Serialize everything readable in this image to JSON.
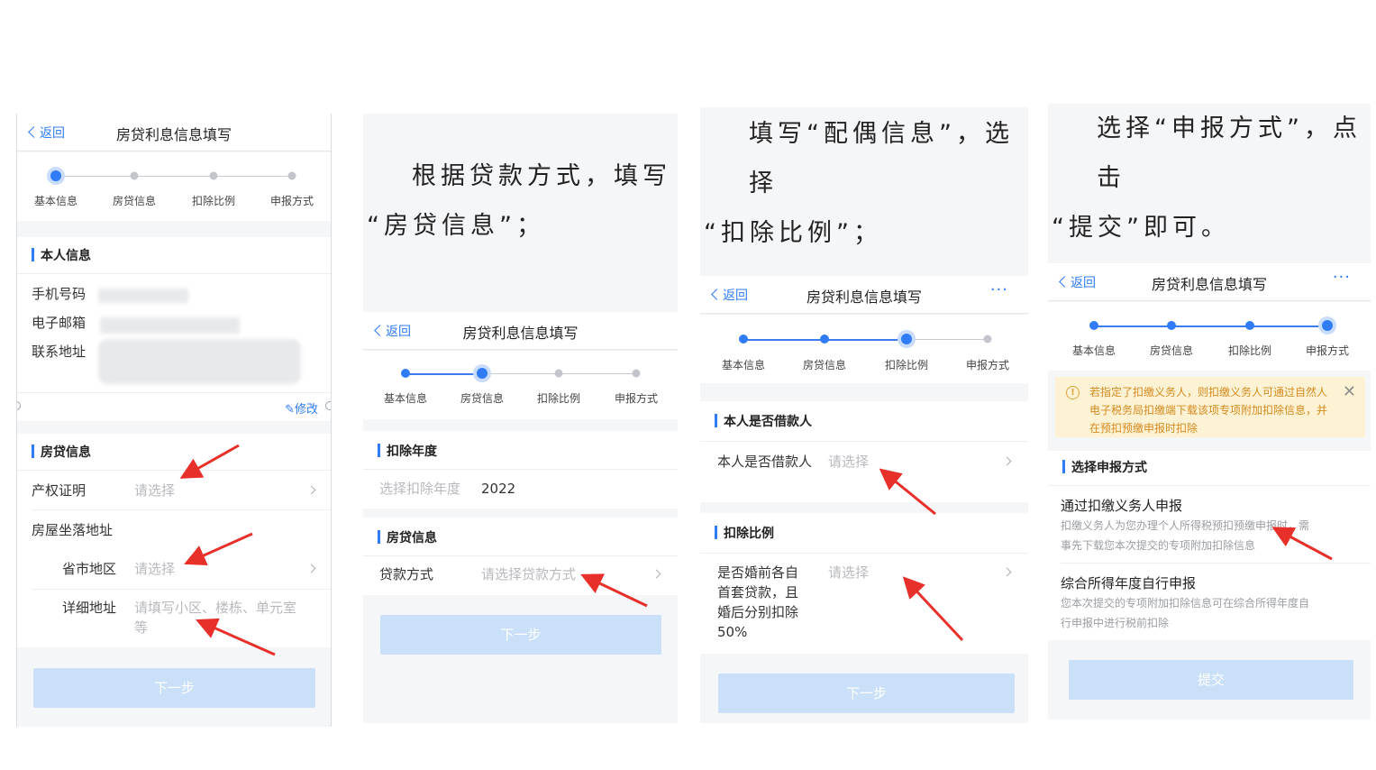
{
  "nav": {
    "back_label": "返回",
    "title": "房贷利息信息填写",
    "more": "···"
  },
  "steps": [
    "基本信息",
    "房贷信息",
    "扣除比例",
    "申报方式"
  ],
  "panel1": {
    "personal_title": "本人信息",
    "phone_label": "手机号码",
    "email_label": "电子邮箱",
    "address_label": "联系地址",
    "edit_label": "修改",
    "loan_title": "房贷信息",
    "property_label": "产权证明",
    "property_value": "请选择",
    "location_label": "房屋坐落地址",
    "region_label": "省市地区",
    "region_value": "请选择",
    "detail_label": "详细地址",
    "detail_placeholder": "请填写小区、楼栋、单元室等",
    "next_button": "下一步"
  },
  "panel2": {
    "caption_line1": "根据贷款方式，填写",
    "caption_line2": "“房贷信息”；",
    "year_title": "扣除年度",
    "year_label": "选择扣除年度",
    "year_value": "2022",
    "loan_title": "房贷信息",
    "method_label": "贷款方式",
    "method_placeholder": "请选择贷款方式",
    "next_button": "下一步"
  },
  "panel3": {
    "caption_line1": "填写“配偶信息”，选择",
    "caption_line2": "“扣除比例”；",
    "borrower_title": "本人是否借款人",
    "borrower_label": "本人是否借款人",
    "borrower_value": "请选择",
    "ratio_title": "扣除比例",
    "ratio_label": "是否婚前各自首套贷款，且婚后分别扣除50%",
    "ratio_value": "请选择",
    "next_button": "下一步"
  },
  "panel4": {
    "caption_line1": "选择“申报方式”，点击",
    "caption_line2": "“提交”即可。",
    "notice": "若指定了扣缴义务人，则扣缴义务人可通过自然人电子税务局扣缴端下载该项专项附加扣除信息，并在预扣预缴申报时扣除",
    "method_title": "选择申报方式",
    "option1_title": "通过扣缴义务人申报",
    "option1_desc": "扣缴义务人为您办理个人所得税预扣预缴申报时，需事先下载您本次提交的专项附加扣除信息",
    "option2_title": "综合所得年度自行申报",
    "option2_desc": "您本次提交的专项附加扣除信息可在综合所得年度自行申报中进行税前扣除",
    "submit_button": "提交"
  },
  "colors": {
    "accent": "#2f7cf6",
    "button_disabled": "#c9e0f8",
    "annotation_arrow": "#e8302a",
    "notice_bg": "#fdf3d4"
  },
  "icons": {
    "back": "chevron-left-icon",
    "row_arrow": "chevron-right-icon",
    "notice": "info-icon",
    "close": "close-icon",
    "edit": "edit-icon",
    "annotation": "red-arrow-icon"
  }
}
